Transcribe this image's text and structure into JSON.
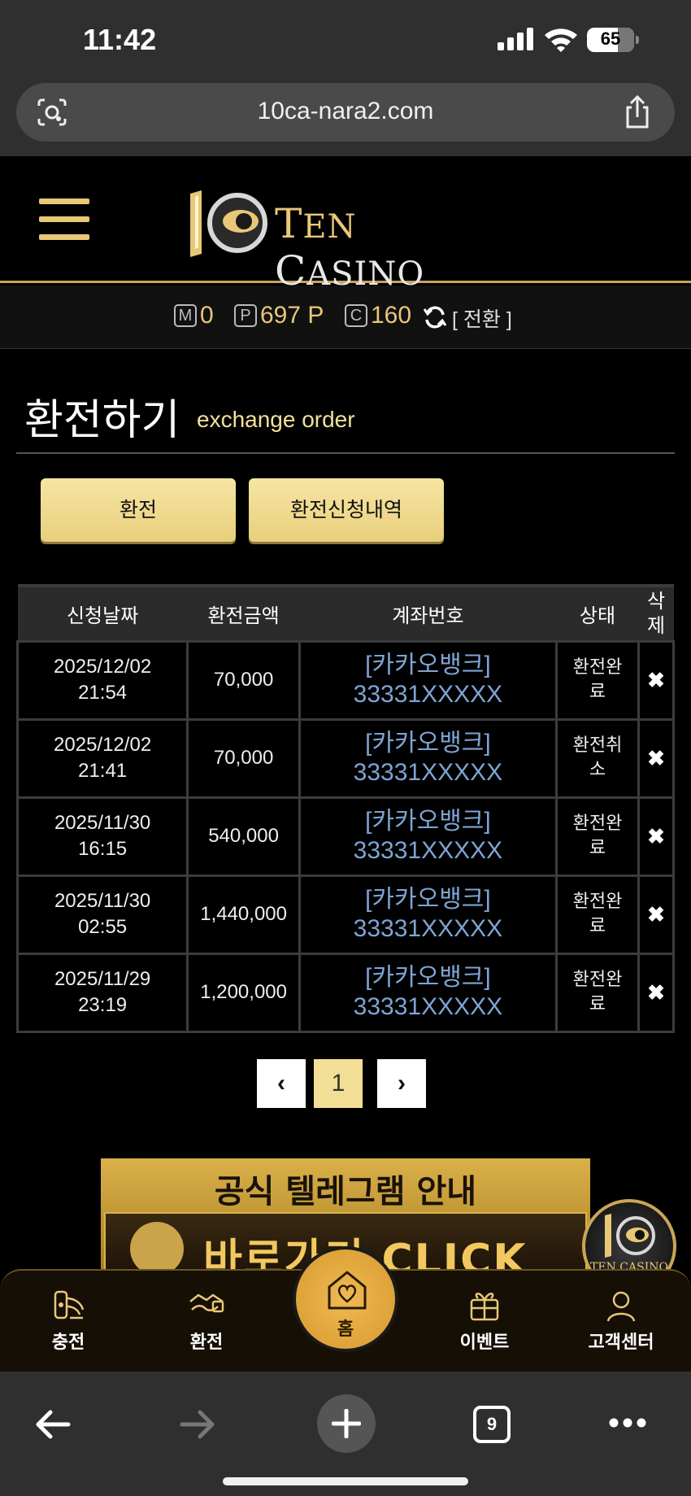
{
  "status_bar": {
    "time": "11:42",
    "battery": "65"
  },
  "browser": {
    "url": "10ca-nara2.com",
    "tab_count": "9"
  },
  "header": {
    "logo_word1_big": "T",
    "logo_word1_small": "EN",
    "logo_word2_big": "C",
    "logo_word2_small": "ASINO",
    "accent_color": "#e8c777"
  },
  "balance": {
    "m_icon": "M",
    "m_value": "0",
    "p_icon": "P",
    "p_value": "697 P",
    "c_icon": "C",
    "c_value": "160",
    "convert_label": "[ 전환 ]"
  },
  "page": {
    "title": "환전하기",
    "subtitle": "exchange order"
  },
  "tabs": [
    {
      "label": "환전"
    },
    {
      "label": "환전신청내역"
    }
  ],
  "table": {
    "headers": {
      "date": "신청날짜",
      "amount": "환전금액",
      "account": "계좌번호",
      "status": "상태",
      "delete_1": "삭",
      "delete_2": "제"
    },
    "rows": [
      {
        "date": "2025/12/02",
        "time": "21:54",
        "amount": "70,000",
        "bank": "[카카오뱅크]",
        "account": "33331XXXXX",
        "status_1": "환전완",
        "status_2": "료",
        "delete": "✖"
      },
      {
        "date": "2025/12/02",
        "time": "21:41",
        "amount": "70,000",
        "bank": "[카카오뱅크]",
        "account": "33331XXXXX",
        "status_1": "환전취",
        "status_2": "소",
        "delete": "✖"
      },
      {
        "date": "2025/11/30",
        "time": "16:15",
        "amount": "540,000",
        "bank": "[카카오뱅크]",
        "account": "33331XXXXX",
        "status_1": "환전완",
        "status_2": "료",
        "delete": "✖"
      },
      {
        "date": "2025/11/30",
        "time": "02:55",
        "amount": "1,440,000",
        "bank": "[카카오뱅크]",
        "account": "33331XXXXX",
        "status_1": "환전완",
        "status_2": "료",
        "delete": "✖"
      },
      {
        "date": "2025/11/29",
        "time": "23:19",
        "amount": "1,200,000",
        "bank": "[카카오뱅크]",
        "account": "33331XXXXX",
        "status_1": "환전완",
        "status_2": "료",
        "delete": "✖"
      }
    ]
  },
  "pagination": {
    "prev": "‹",
    "current": "1",
    "next": "›"
  },
  "banner": {
    "title": "공식 텔레그램 안내",
    "cta": "바로가기 CLICK"
  },
  "floating_logo": {
    "text": "TEN CASINO"
  },
  "bottom_nav": {
    "items": [
      {
        "label": "충전",
        "icon": "charge-icon"
      },
      {
        "label": "환전",
        "icon": "exchange-icon"
      },
      {
        "label": "홈",
        "icon": "home-heart-icon"
      },
      {
        "label": "이벤트",
        "icon": "gift-icon"
      },
      {
        "label": "고객센터",
        "icon": "support-icon"
      }
    ]
  }
}
